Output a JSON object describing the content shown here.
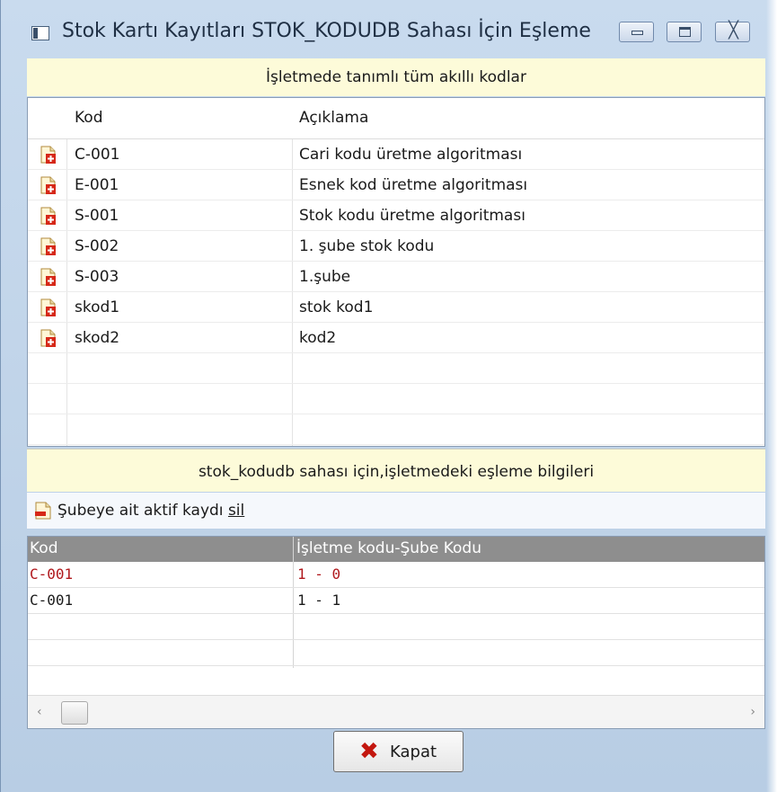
{
  "window": {
    "title": "Stok Kartı Kayıtları STOK_KODUDB Sahası İçin Eşleme",
    "icon": "window-app-icon",
    "controls": {
      "minimize": "minimize-icon",
      "maximize": "maximize-icon",
      "close": "╳"
    }
  },
  "top_band": {
    "text": "İşletmede tanımlı tüm akıllı kodlar"
  },
  "smart_codes": {
    "columns": {
      "kod": "Kod",
      "aciklama": "Açıklama"
    },
    "row_icon": "document-add-icon",
    "rows": [
      {
        "kod": "C-001",
        "aciklama": "Cari kodu üretme algoritması"
      },
      {
        "kod": "E-001",
        "aciklama": "Esnek kod üretme algoritması"
      },
      {
        "kod": "S-001",
        "aciklama": "Stok kodu üretme algoritması"
      },
      {
        "kod": "S-002",
        "aciklama": "1. şube stok kodu"
      },
      {
        "kod": "S-003",
        "aciklama": "1.şube"
      },
      {
        "kod": "skod1",
        "aciklama": "stok kod1"
      },
      {
        "kod": "skod2",
        "aciklama": "kod2"
      }
    ]
  },
  "mid_band": {
    "text": "stok_kodudb sahası için,işletmedeki eşleme bilgileri"
  },
  "toolbar": {
    "delete_label_pre": "Şubeye ait aktif kaydı ",
    "delete_label_key": "sil",
    "delete_icon": "document-remove-icon"
  },
  "mapping": {
    "columns": {
      "kod": "Kod",
      "isletme_sube": "İşletme kodu-Şube Kodu"
    },
    "rows": [
      {
        "kod": "C-001",
        "isletme_sube": "1 - 0",
        "selected": true
      },
      {
        "kod": "C-001",
        "isletme_sube": "1 - 1",
        "selected": false
      }
    ]
  },
  "scrollbar": {
    "left_arrow": "‹",
    "right_arrow": "›"
  },
  "close_button": {
    "label": "Kapat",
    "icon": "✖"
  },
  "colors": {
    "band": "#fdfbd9",
    "frame": "#c9dbee",
    "selected_text": "#b0181c",
    "header_gray": "#8e8e8e"
  }
}
